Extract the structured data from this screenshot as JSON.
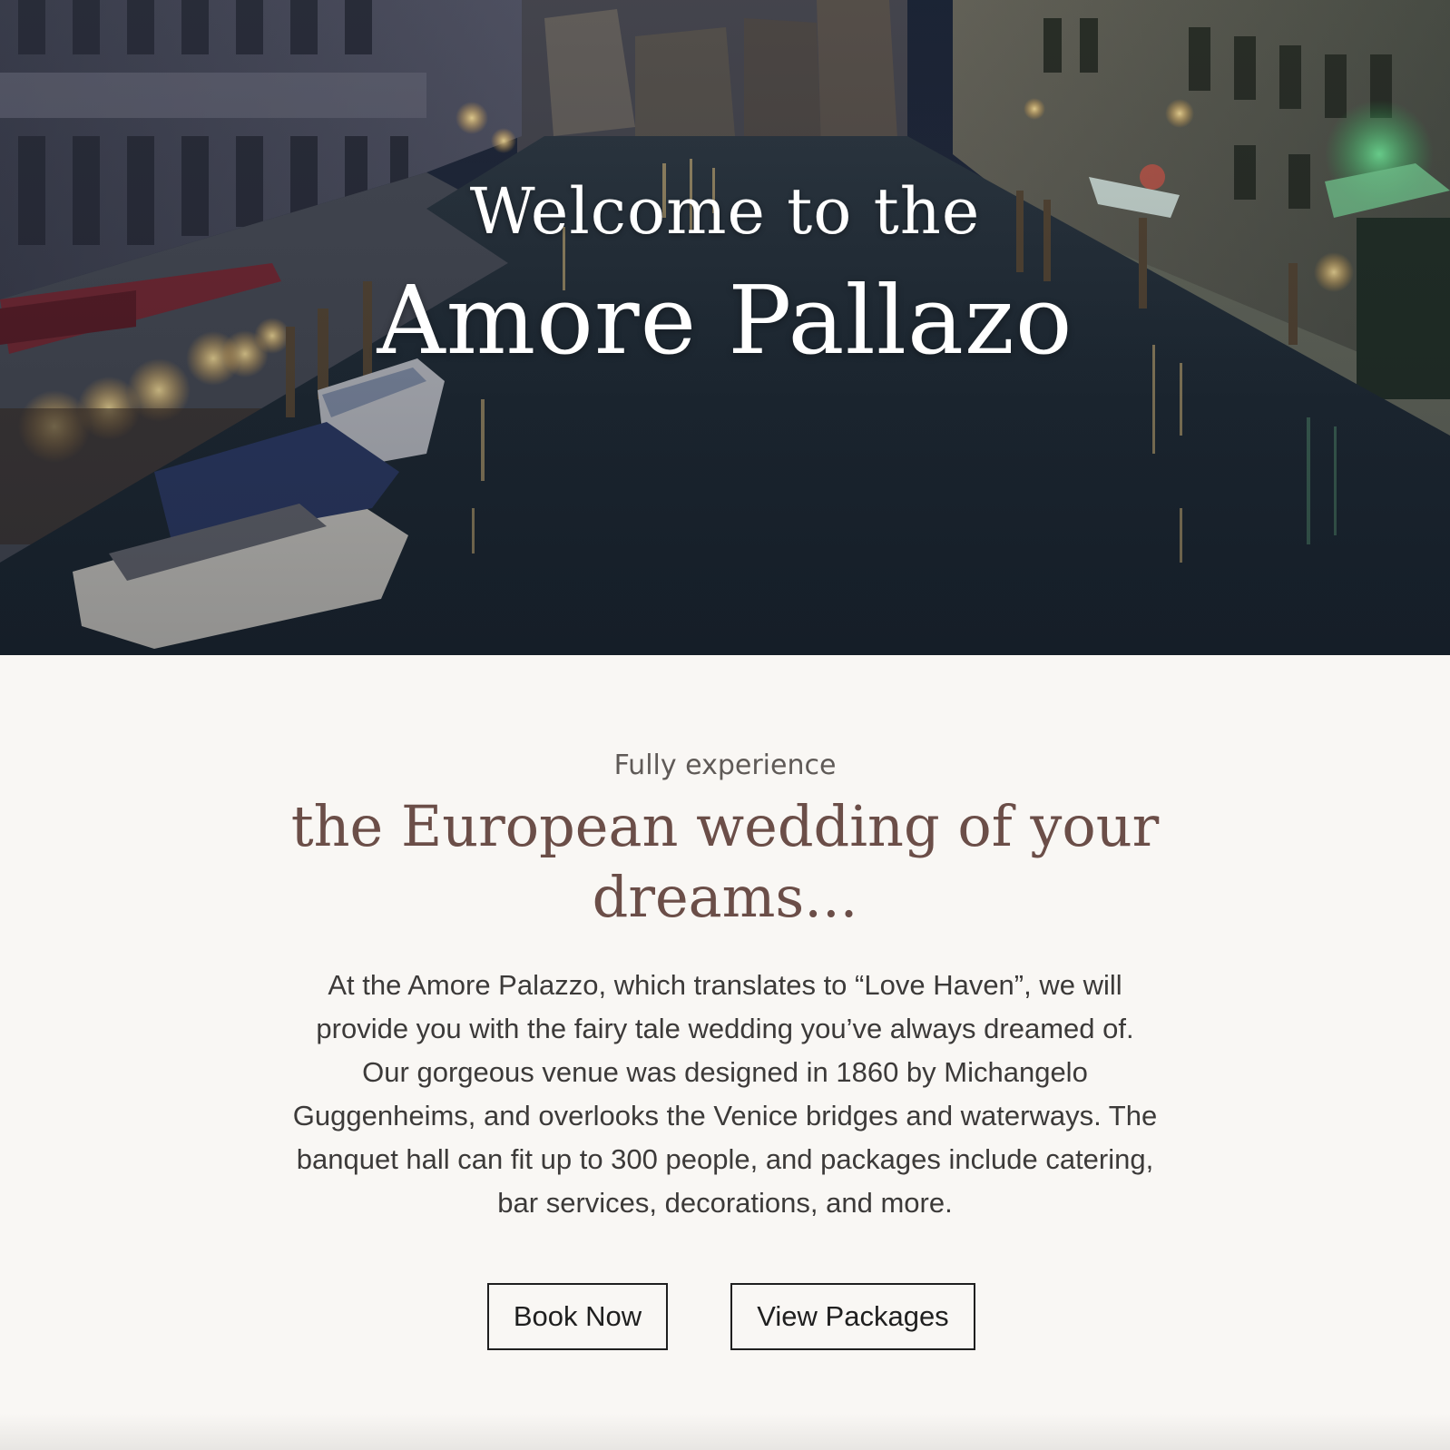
{
  "hero": {
    "welcome": "Welcome to the",
    "title": "Amore Pallazo",
    "image_alt": "Venice canal at dusk with boats and lit buildings"
  },
  "intro": {
    "eyebrow": "Fully experience",
    "headline": "the European wedding of your dreams...",
    "body": "At the Amore Palazzo, which translates to “Love Haven”, we will provide you with the fairy tale wedding you’ve always dreamed of. Our gorgeous venue was designed in 1860 by Michangelo Guggenheims, and overlooks the Venice bridges and waterways. The banquet hall can fit up to 300 people, and packages include catering, bar services, decorations, and more.",
    "buttons": {
      "book": "Book Now",
      "packages": "View Packages"
    }
  },
  "colors": {
    "page_bg": "#f9f7f4",
    "headline": "#6b4e48",
    "body_text": "#3c3a39",
    "button_border": "#1f1f1f"
  }
}
